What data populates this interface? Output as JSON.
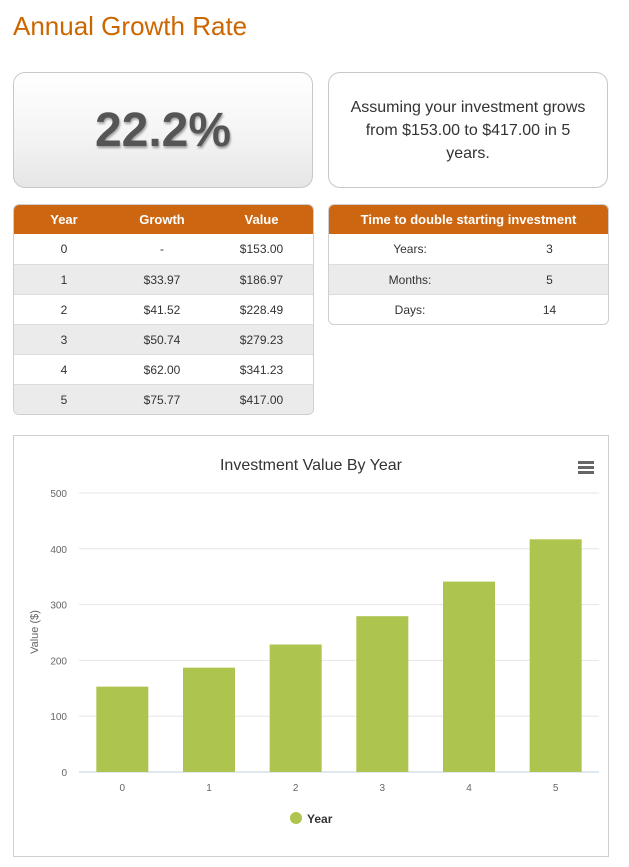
{
  "page": {
    "title": "Annual Growth Rate"
  },
  "summary": {
    "rate": "22.2%",
    "assumption": "Assuming your investment grows from $153.00 to $417.00 in 5 years."
  },
  "growth_table": {
    "headers": [
      "Year",
      "Growth",
      "Value"
    ],
    "rows": [
      [
        "0",
        "-",
        "$153.00"
      ],
      [
        "1",
        "$33.97",
        "$186.97"
      ],
      [
        "2",
        "$41.52",
        "$228.49"
      ],
      [
        "3",
        "$50.74",
        "$279.23"
      ],
      [
        "4",
        "$62.00",
        "$341.23"
      ],
      [
        "5",
        "$75.77",
        "$417.00"
      ]
    ]
  },
  "double_table": {
    "header": "Time to double starting investment",
    "rows": [
      [
        "Years:",
        "3"
      ],
      [
        "Months:",
        "5"
      ],
      [
        "Days:",
        "14"
      ]
    ]
  },
  "chart_data": {
    "type": "bar",
    "title": "Investment Value By Year",
    "xlabel": "",
    "ylabel": "Value ($)",
    "categories": [
      "0",
      "1",
      "2",
      "3",
      "4",
      "5"
    ],
    "series": [
      {
        "name": "Year",
        "values": [
          153.0,
          186.97,
          228.49,
          279.23,
          341.23,
          417.0
        ]
      }
    ],
    "ylim": [
      0,
      500
    ],
    "yticks": [
      0,
      100,
      200,
      300,
      400,
      500
    ],
    "grid": true,
    "legend": "bottom-center",
    "bar_color": "#adc44f"
  },
  "colors": {
    "accent": "#cc6611",
    "title": "#cc6600",
    "bar": "#adc44f"
  },
  "icons": {
    "chart_menu": "hamburger-menu-icon"
  }
}
